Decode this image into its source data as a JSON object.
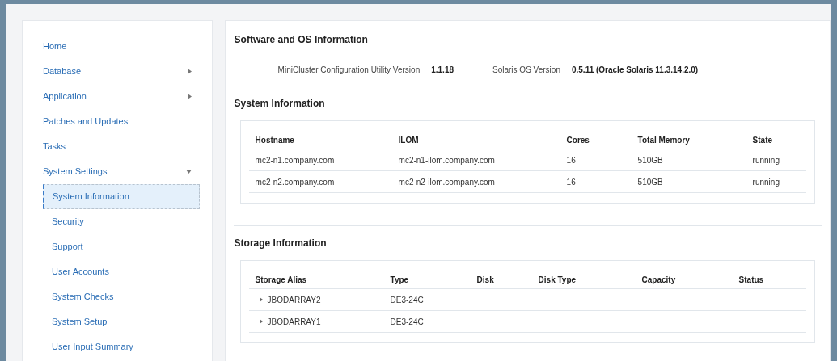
{
  "sidebar": {
    "items": [
      {
        "label": "Home"
      },
      {
        "label": "Database",
        "expanded": false
      },
      {
        "label": "Application",
        "expanded": false
      },
      {
        "label": "Patches and Updates"
      },
      {
        "label": "Tasks"
      },
      {
        "label": "System Settings",
        "expanded": true,
        "children": [
          {
            "label": "System Information",
            "selected": true
          },
          {
            "label": "Security",
            "selected": false
          },
          {
            "label": "Support",
            "selected": false
          },
          {
            "label": "User Accounts",
            "selected": false
          },
          {
            "label": "System Checks",
            "selected": false
          },
          {
            "label": "System Setup",
            "selected": false
          },
          {
            "label": "User Input Summary",
            "selected": false
          }
        ]
      }
    ]
  },
  "software_section": {
    "title": "Software and OS Information",
    "fields": [
      {
        "label": "MiniCluster Configuration Utility Version",
        "value": "1.1.18"
      },
      {
        "label": "Solaris OS Version",
        "value": "0.5.11 (Oracle Solaris 11.3.14.2.0)"
      }
    ]
  },
  "system_section": {
    "title": "System Information",
    "table": {
      "columns": [
        "Hostname",
        "ILOM",
        "Cores",
        "Total Memory",
        "State"
      ],
      "rows": [
        [
          "mc2-n1.company.com",
          "mc2-n1-ilom.company.com",
          "16",
          "510GB",
          "running"
        ],
        [
          "mc2-n2.company.com",
          "mc2-n2-ilom.company.com",
          "16",
          "510GB",
          "running"
        ]
      ]
    }
  },
  "storage_section": {
    "title": "Storage Information",
    "table": {
      "columns": [
        "Storage Alias",
        "Type",
        "Disk",
        "Disk Type",
        "Capacity",
        "Status"
      ],
      "rows": [
        {
          "expanded": false,
          "cells": [
            "JBODARRAY2",
            "DE3-24C"
          ]
        },
        {
          "expanded": false,
          "cells": [
            "JBODARRAY1",
            "DE3-24C"
          ]
        }
      ]
    }
  }
}
